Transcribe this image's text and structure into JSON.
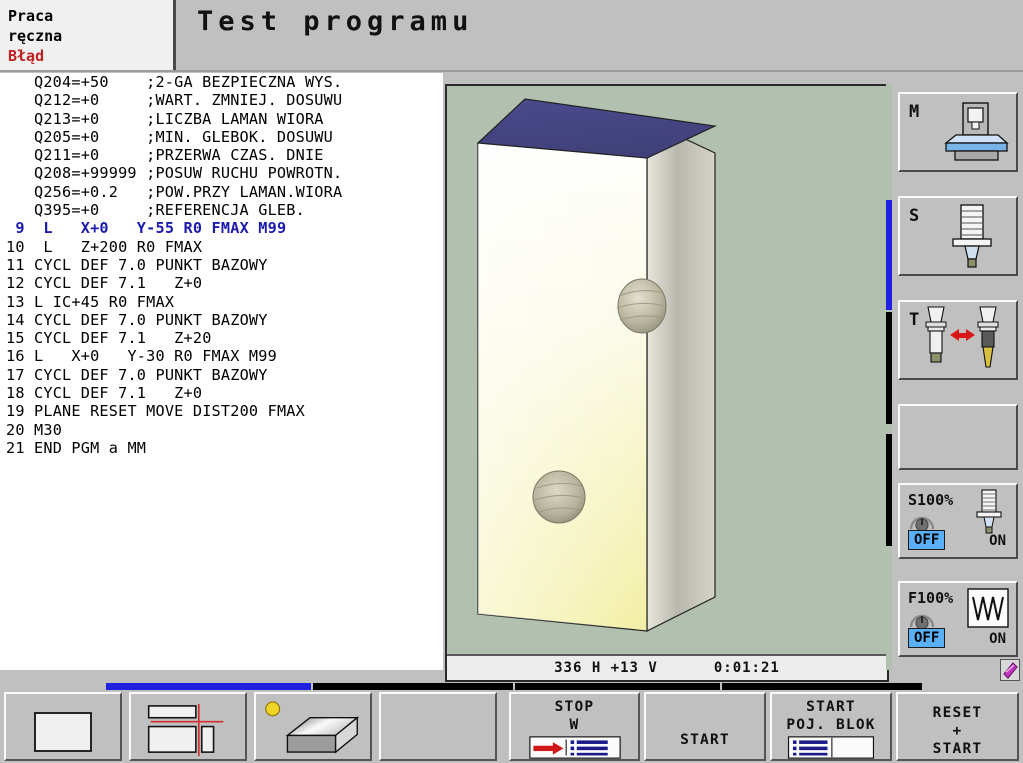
{
  "header": {
    "mode_lines": [
      "Praca",
      "ręczna"
    ],
    "error_label": "Błąd",
    "title": "Test programu"
  },
  "program": {
    "lines": [
      {
        "text": "Q204=+50    ;2-GA BEZPIECZNA WYS.",
        "style": "param"
      },
      {
        "text": "Q212=+0     ;WART. ZMNIEJ. DOSUWU",
        "style": "param"
      },
      {
        "text": "Q213=+0     ;LICZBA LAMAN WIORA",
        "style": "param"
      },
      {
        "text": "Q205=+0     ;MIN. GLEBOK. DOSUWU",
        "style": "param"
      },
      {
        "text": "Q211=+0     ;PRZERWA CZAS. DNIE",
        "style": "param"
      },
      {
        "text": "Q208=+99999 ;POSUW RUCHU POWROTN.",
        "style": "param"
      },
      {
        "text": "Q256=+0.2   ;POW.PRZY LAMAN.WIORA",
        "style": "param"
      },
      {
        "text": "Q395=+0     ;REFERENCJA GLEB.",
        "style": "param"
      },
      {
        "text": " 9  L   X+0   Y-55 R0 FMAX M99",
        "style": "active"
      },
      {
        "text": "10  L   Z+200 R0 FMAX",
        "style": "normal"
      },
      {
        "text": "11 CYCL DEF 7.0 PUNKT BAZOWY",
        "style": "normal"
      },
      {
        "text": "12 CYCL DEF 7.1   Z+0",
        "style": "normal"
      },
      {
        "text": "13 L IC+45 R0 FMAX",
        "style": "normal"
      },
      {
        "text": "14 CYCL DEF 7.0 PUNKT BAZOWY",
        "style": "normal"
      },
      {
        "text": "15 CYCL DEF 7.1   Z+20",
        "style": "normal"
      },
      {
        "text": "16 L   X+0   Y-30 R0 FMAX M99",
        "style": "normal"
      },
      {
        "text": "17 CYCL DEF 7.0 PUNKT BAZOWY",
        "style": "normal"
      },
      {
        "text": "18 CYCL DEF 7.1   Z+0",
        "style": "normal"
      },
      {
        "text": "19 PLANE RESET MOVE DIST200 FMAX",
        "style": "normal"
      },
      {
        "text": "20 M30",
        "style": "normal"
      },
      {
        "text": "21 END PGM a MM",
        "style": "normal"
      }
    ]
  },
  "viewport": {
    "status_left": "336 H  +13 V",
    "status_right": "0:01:21",
    "background_color": "#b2c0b0",
    "top_face_color": "#4a4a86",
    "front_face_top_color": "#ffffff",
    "front_face_bottom_color": "#f0eeaa",
    "side_face_color": "#c8c8c8"
  },
  "right_softkeys": [
    {
      "name": "machine-status",
      "letter": "M",
      "icon": "machine-icon"
    },
    {
      "name": "spindle-status",
      "letter": "S",
      "icon": "spindle-tool-icon"
    },
    {
      "name": "tool-change-status",
      "letter": "T",
      "icon": "tool-change-icon"
    },
    {
      "name": "empty-status",
      "letter": "",
      "icon": ""
    }
  ],
  "overrides": [
    {
      "name": "spindle-override",
      "label": "S100%",
      "off_label": "OFF",
      "on_label": "ON",
      "icon": "spindle-tool-icon",
      "active": "OFF"
    },
    {
      "name": "feed-override",
      "label": "F100%",
      "off_label": "OFF",
      "on_label": "ON",
      "icon": "zigzag-feed-icon",
      "active": "OFF"
    }
  ],
  "bottom_softkeys": [
    {
      "name": "view-single-window",
      "lines": [],
      "icon": "single-window-icon"
    },
    {
      "name": "view-split-window",
      "lines": [],
      "icon": "split-window-crosshair-icon"
    },
    {
      "name": "view-3d-solid",
      "lines": [],
      "icon": "solid-block-icon"
    },
    {
      "name": "softkey-empty",
      "lines": [],
      "icon": ""
    },
    {
      "name": "stop-at-block",
      "lines": [
        "STOP",
        "W"
      ],
      "icon": "stop-block-list-icon"
    },
    {
      "name": "start-button",
      "lines": [
        "START"
      ],
      "icon": ""
    },
    {
      "name": "start-single-block",
      "lines": [
        "START",
        "POJ. BLOK"
      ],
      "icon": "single-block-list-icon"
    },
    {
      "name": "reset-start-button",
      "lines": [
        "RESET",
        "+",
        "START"
      ],
      "icon": ""
    }
  ],
  "colors": {
    "accent_blue": "#1a1ab0",
    "highlight_blue": "#59b0f8",
    "progress_blue": "#2020e0",
    "error_red": "#c02020",
    "panel_gray": "#c0c0c0"
  },
  "notification": {
    "name": "note-icon",
    "color": "#b030b0"
  }
}
